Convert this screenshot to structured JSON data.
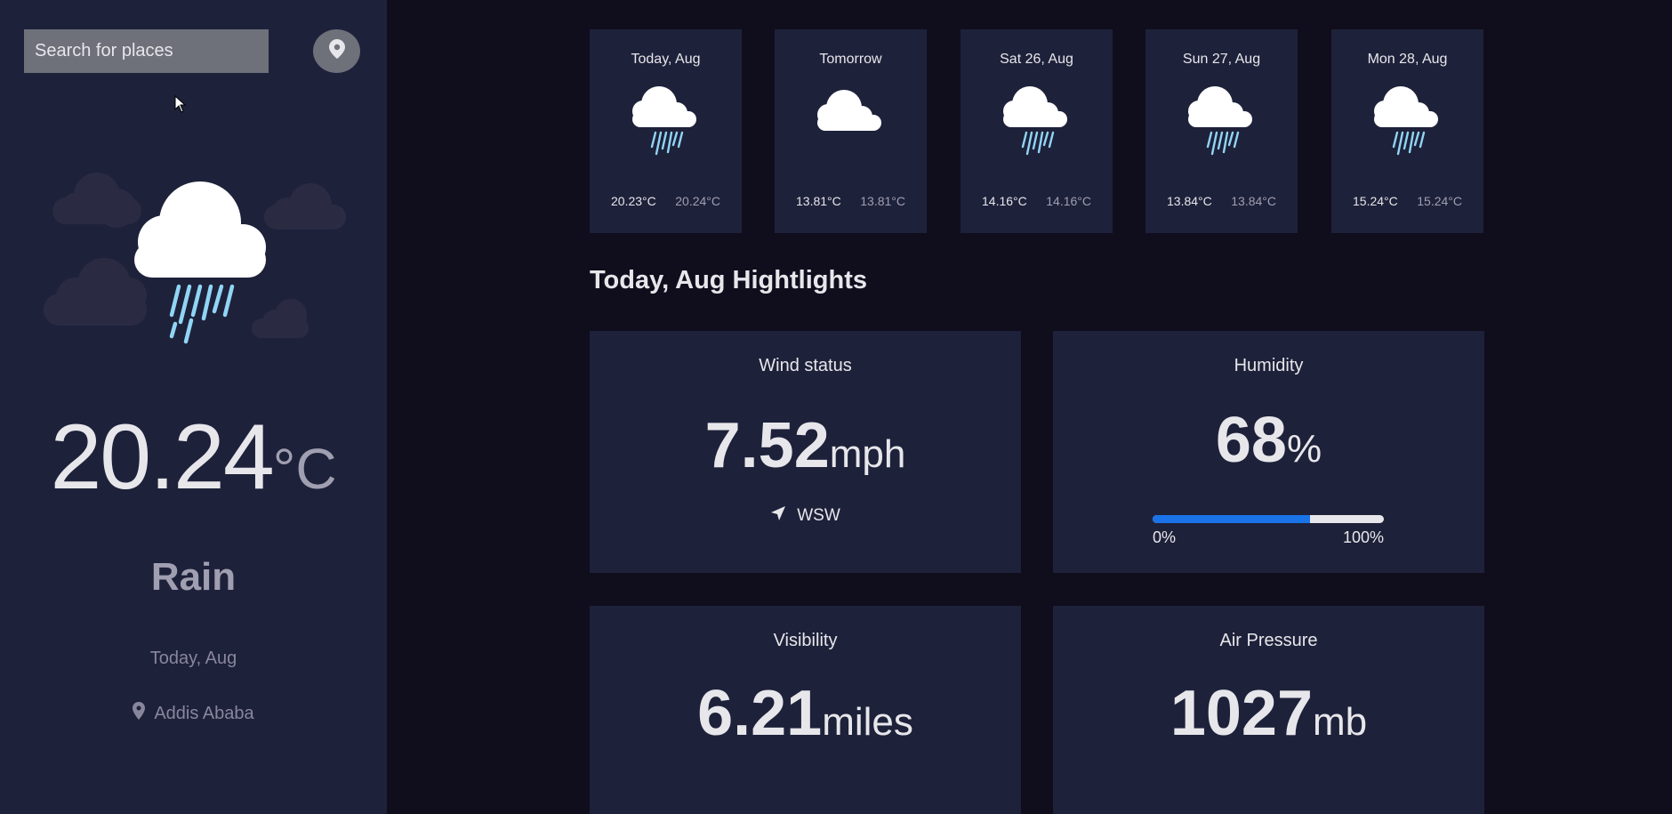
{
  "search": {
    "placeholder": "Search for places"
  },
  "sidebar": {
    "temperature": "20.24",
    "unit": "°C",
    "condition": "Rain",
    "date": "Today, Aug",
    "location": "Addis Ababa"
  },
  "forecast": [
    {
      "date": "Today, Aug",
      "icon": "rain-cloud-icon",
      "max": "20.23°C",
      "min": "20.24°C"
    },
    {
      "date": "Tomorrow",
      "icon": "cloud-icon",
      "max": "13.81°C",
      "min": "13.81°C"
    },
    {
      "date": "Sat 26, Aug",
      "icon": "rain-cloud-icon",
      "max": "14.16°C",
      "min": "14.16°C"
    },
    {
      "date": "Sun 27, Aug",
      "icon": "rain-cloud-icon",
      "max": "13.84°C",
      "min": "13.84°C"
    },
    {
      "date": "Mon 28, Aug",
      "icon": "rain-cloud-icon",
      "max": "15.24°C",
      "min": "15.24°C"
    }
  ],
  "highlights": {
    "title": "Today, Aug Hightlights",
    "wind": {
      "label": "Wind status",
      "value": "7.52",
      "unit": "mph",
      "direction": "WSW"
    },
    "humidity": {
      "label": "Humidity",
      "value": "68",
      "unit": "%",
      "percent": 68,
      "min_label": "0%",
      "max_label": "100%"
    },
    "visibility": {
      "label": "Visibility",
      "value": "6.21",
      "unit": "miles"
    },
    "pressure": {
      "label": "Air Pressure",
      "value": "1027",
      "unit": "mb"
    }
  },
  "colors": {
    "sidebar": "#1e213a",
    "background": "#100e1d",
    "accent": "#1a73e8",
    "rain": "#91d5f5"
  }
}
